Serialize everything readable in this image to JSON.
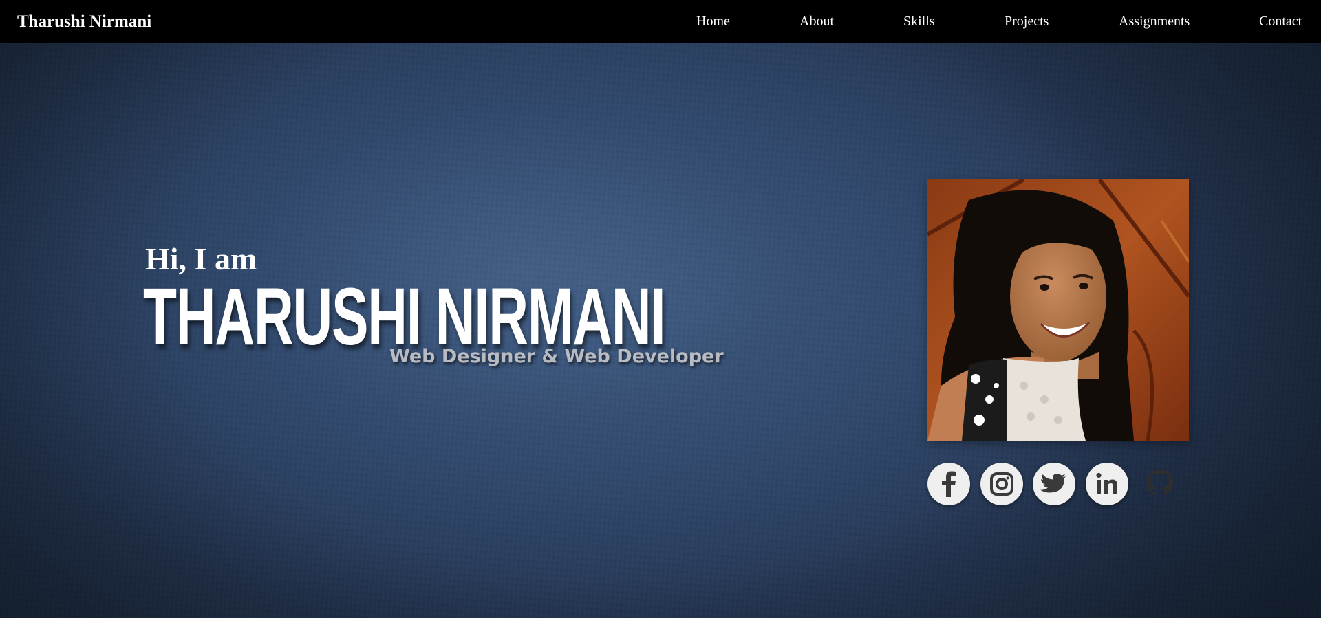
{
  "navbar": {
    "brand": "Tharushi Nirmani",
    "links": [
      {
        "label": "Home"
      },
      {
        "label": "About"
      },
      {
        "label": "Skills"
      },
      {
        "label": "Projects"
      },
      {
        "label": "Assignments"
      },
      {
        "label": "Contact"
      }
    ],
    "background_color": "#000000",
    "text_color": "#ffffff"
  },
  "hero": {
    "greeting": "Hi, I am",
    "name": "THARUSHI NIRMANI",
    "role": "Web Designer & Web Developer",
    "background_color": "#2c4163",
    "role_color": "#b8bcc2",
    "photo": {
      "icon": "profile-photo"
    },
    "social_links": [
      {
        "icon": "facebook-icon"
      },
      {
        "icon": "instagram-icon"
      },
      {
        "icon": "twitter-icon"
      },
      {
        "icon": "linkedin-icon"
      },
      {
        "icon": "github-icon"
      }
    ]
  }
}
